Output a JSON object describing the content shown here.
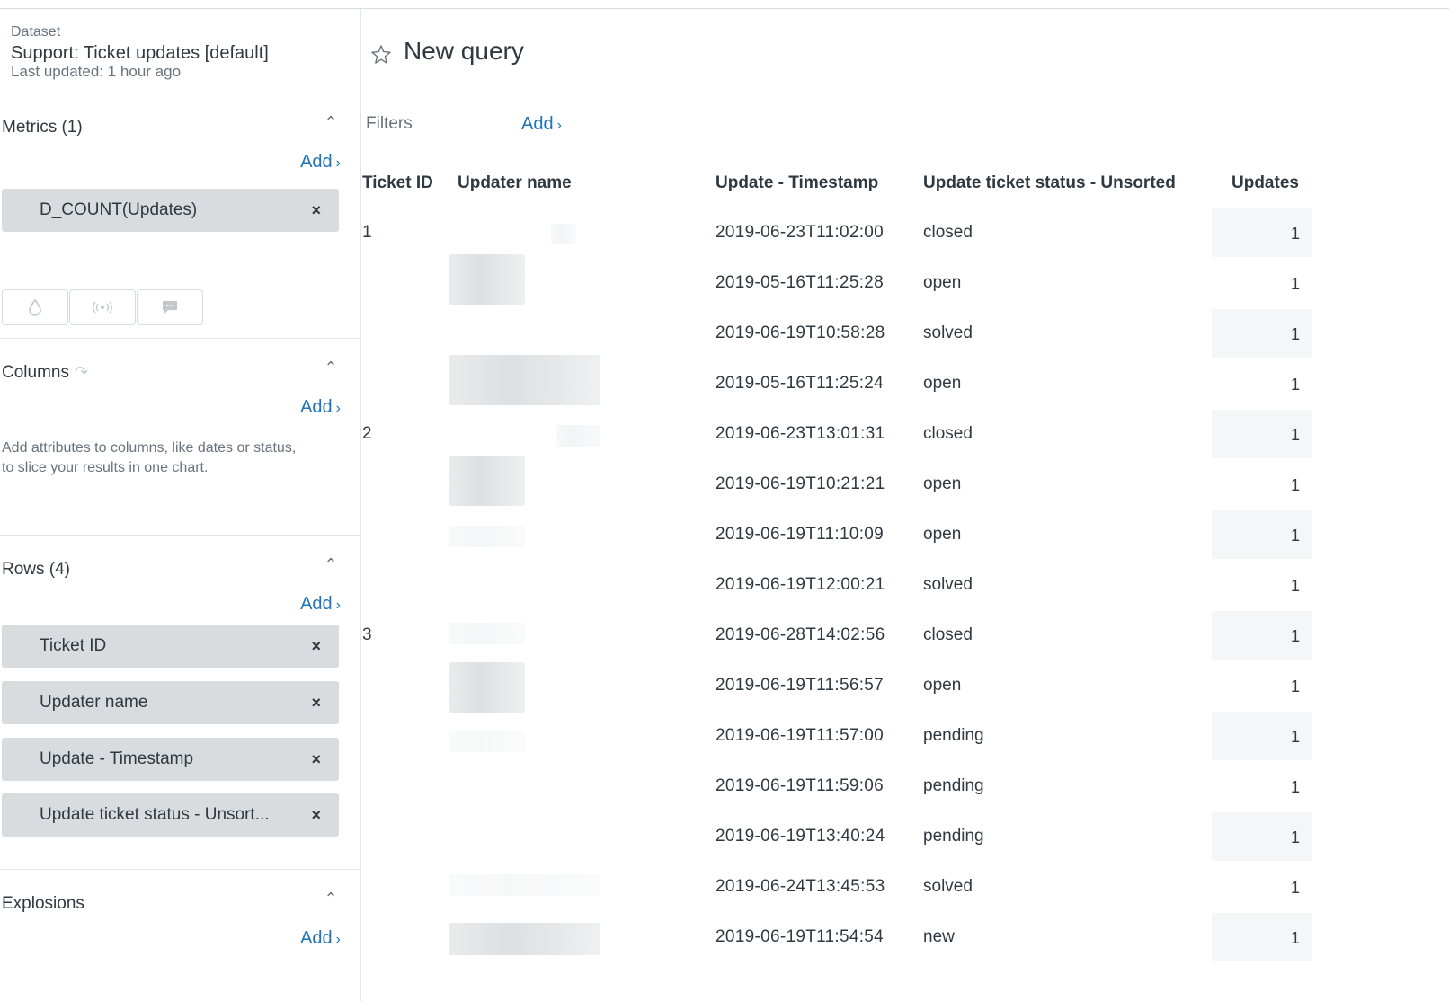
{
  "dataset": {
    "label": "Dataset",
    "name": "Support: Ticket updates [default]",
    "updated": "Last updated: 1 hour ago"
  },
  "metrics": {
    "title": "Metrics (1)",
    "add_label": "Add",
    "items": [
      {
        "label": "D_COUNT(Updates)"
      }
    ]
  },
  "columns": {
    "title": "Columns",
    "add_label": "Add",
    "help": "Add attributes to columns, like dates or status, to slice your results in one chart."
  },
  "rows": {
    "title": "Rows (4)",
    "add_label": "Add",
    "items": [
      {
        "label": "Ticket ID"
      },
      {
        "label": "Updater name"
      },
      {
        "label": "Update - Timestamp"
      },
      {
        "label": "Update ticket status - Unsort..."
      }
    ]
  },
  "explosions": {
    "title": "Explosions",
    "add_label": "Add"
  },
  "query": {
    "title": "New query",
    "filters_label": "Filters",
    "filters_add": "Add"
  },
  "table": {
    "headers": [
      "Ticket ID",
      "Updater name",
      "Update - Timestamp",
      "Update ticket status - Unsorted",
      "Updates"
    ],
    "rows": [
      {
        "ticket": "1",
        "timestamp": "2019-06-23T11:02:00",
        "status": "closed",
        "updates": "1"
      },
      {
        "ticket": "",
        "timestamp": "2019-05-16T11:25:28",
        "status": "open",
        "updates": "1"
      },
      {
        "ticket": "",
        "timestamp": "2019-06-19T10:58:28",
        "status": "solved",
        "updates": "1"
      },
      {
        "ticket": "",
        "timestamp": "2019-05-16T11:25:24",
        "status": "open",
        "updates": "1"
      },
      {
        "ticket": "2",
        "timestamp": "2019-06-23T13:01:31",
        "status": "closed",
        "updates": "1"
      },
      {
        "ticket": "",
        "timestamp": "2019-06-19T10:21:21",
        "status": "open",
        "updates": "1"
      },
      {
        "ticket": "",
        "timestamp": "2019-06-19T11:10:09",
        "status": "open",
        "updates": "1"
      },
      {
        "ticket": "",
        "timestamp": "2019-06-19T12:00:21",
        "status": "solved",
        "updates": "1"
      },
      {
        "ticket": "3",
        "timestamp": "2019-06-28T14:02:56",
        "status": "closed",
        "updates": "1"
      },
      {
        "ticket": "",
        "timestamp": "2019-06-19T11:56:57",
        "status": "open",
        "updates": "1"
      },
      {
        "ticket": "",
        "timestamp": "2019-06-19T11:57:00",
        "status": "pending",
        "updates": "1"
      },
      {
        "ticket": "",
        "timestamp": "2019-06-19T11:59:06",
        "status": "pending",
        "updates": "1"
      },
      {
        "ticket": "",
        "timestamp": "2019-06-19T13:40:24",
        "status": "pending",
        "updates": "1"
      },
      {
        "ticket": "",
        "timestamp": "2019-06-24T13:45:53",
        "status": "solved",
        "updates": "1"
      },
      {
        "ticket": "",
        "timestamp": "2019-06-19T11:54:54",
        "status": "new",
        "updates": "1"
      }
    ]
  },
  "icons": {
    "star": "star-outline-icon",
    "close": "close-icon",
    "caret": "chevron-up-icon",
    "viz": [
      "drop-icon",
      "signal-icon",
      "comment-icon"
    ]
  },
  "colors": {
    "link": "#1f73b7",
    "pill": "#d8dcde",
    "text": "#2f3941",
    "muted": "#68737d"
  }
}
